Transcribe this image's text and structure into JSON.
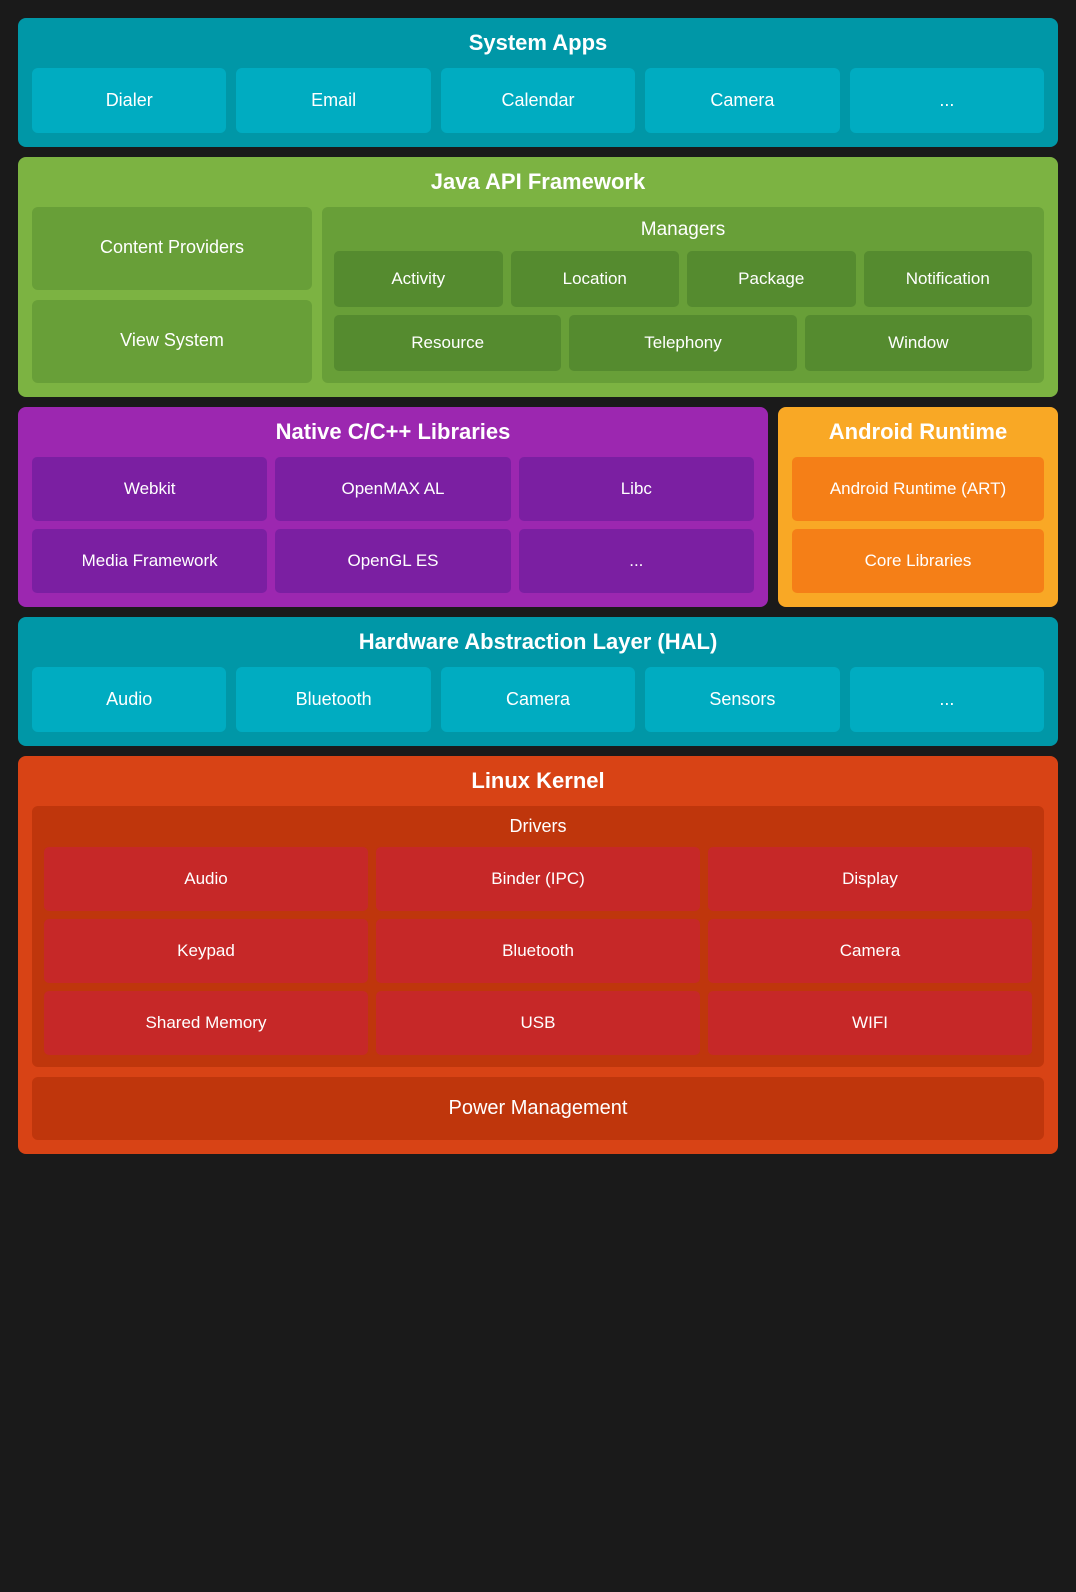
{
  "system_apps": {
    "title": "System Apps",
    "apps": [
      "Dialer",
      "Email",
      "Calendar",
      "Camera",
      "..."
    ]
  },
  "java_api": {
    "title": "Java API Framework",
    "content_providers": "Content Providers",
    "view_system": "View System",
    "managers_title": "Managers",
    "managers_row1": [
      "Activity",
      "Location",
      "Package",
      "Notification"
    ],
    "managers_row2": [
      "Resource",
      "Telephony",
      "Window"
    ]
  },
  "native_cpp": {
    "title": "Native C/C++ Libraries",
    "row1": [
      "Webkit",
      "OpenMAX AL",
      "Libc"
    ],
    "row2": [
      "Media Framework",
      "OpenGL ES",
      "..."
    ]
  },
  "android_runtime": {
    "title": "Android Runtime",
    "art": "Android Runtime (ART)",
    "core": "Core Libraries"
  },
  "hal": {
    "title": "Hardware Abstraction Layer (HAL)",
    "items": [
      "Audio",
      "Bluetooth",
      "Camera",
      "Sensors",
      "..."
    ]
  },
  "linux_kernel": {
    "title": "Linux Kernel",
    "drivers_title": "Drivers",
    "drivers_row1": [
      "Audio",
      "Binder (IPC)",
      "Display"
    ],
    "drivers_row2": [
      "Keypad",
      "Bluetooth",
      "Camera"
    ],
    "drivers_row3": [
      "Shared Memory",
      "USB",
      "WIFI"
    ],
    "power_management": "Power Management"
  }
}
